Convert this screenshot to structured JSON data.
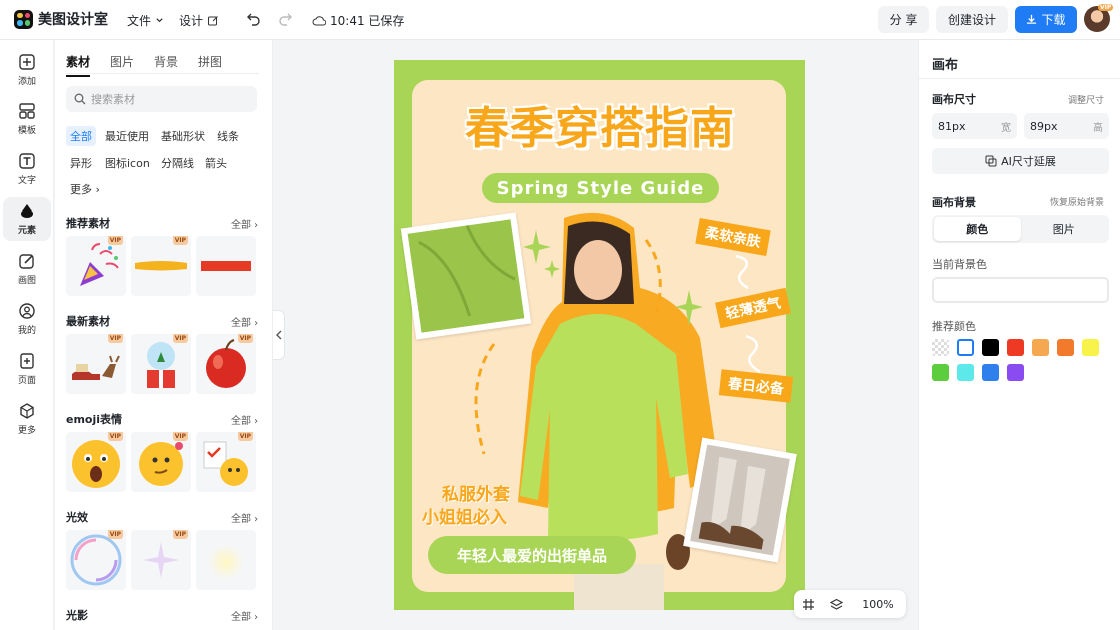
{
  "app": {
    "name": "美图设计室"
  },
  "topbar": {
    "file_label": "文件",
    "design_label": "设计",
    "saved_text": "10:41 已保存",
    "share_label": "分 享",
    "create_label": "创建设计",
    "download_label": "下载",
    "avatar_badge": "VIP"
  },
  "rail": {
    "items": [
      {
        "label": "添加",
        "icon": "plus-square-icon"
      },
      {
        "label": "模板",
        "icon": "template-icon"
      },
      {
        "label": "文字",
        "icon": "text-icon"
      },
      {
        "label": "元素",
        "icon": "shapes-icon"
      },
      {
        "label": "画图",
        "icon": "pen-icon"
      },
      {
        "label": "我的",
        "icon": "user-icon"
      },
      {
        "label": "页面",
        "icon": "page-add-icon"
      },
      {
        "label": "更多",
        "icon": "cube-icon"
      }
    ]
  },
  "panel": {
    "tabs": [
      "素材",
      "图片",
      "背景",
      "拼图"
    ],
    "search_placeholder": "搜索素材",
    "chips": [
      "全部",
      "最近使用",
      "基础形状",
      "线条",
      "异形",
      "图标icon",
      "分隔线",
      "箭头",
      "更多"
    ],
    "sections": [
      {
        "title": "推荐素材",
        "all": "全部"
      },
      {
        "title": "最新素材",
        "all": "全部"
      },
      {
        "title": "emoji表情",
        "all": "全部"
      },
      {
        "title": "光效",
        "all": "全部"
      },
      {
        "title": "光影",
        "all": "全部"
      }
    ],
    "vip_label": "VIP"
  },
  "poster": {
    "title": "春季穿搭指南",
    "subtitle": "Spring Style Guide",
    "tag1": "柔软亲肤",
    "tag2": "轻薄透气",
    "tag3": "春日必备",
    "side_line1": "私服外套",
    "side_line2": "小姐姐必入",
    "bottom_pill": "年轻人最爱的出街单品",
    "colors": {
      "green": "#a9d557",
      "cream": "#fde6c4",
      "orange": "#f9a71a"
    }
  },
  "zoom": {
    "level": "100%"
  },
  "right_panel": {
    "title": "画布",
    "size_label": "画布尺寸",
    "adjust_size": "调整尺寸",
    "width_value": "81px",
    "width_unit": "宽",
    "height_value": "89px",
    "height_unit": "高",
    "ai_extend": "AI尺寸延展",
    "bg_label": "画布背景",
    "restore_bg": "恢复原始背景",
    "seg_color": "颜色",
    "seg_image": "图片",
    "current_bg_label": "当前背景色",
    "recommend_label": "推荐颜色",
    "swatches": [
      "transparent",
      "#ffffff",
      "#000000",
      "#ee3a24",
      "#f5a850",
      "#f27a2c",
      "#f8f34a",
      "#5ccd3c",
      "#5de8ea",
      "#2f80ed",
      "#8a4cf0"
    ]
  }
}
